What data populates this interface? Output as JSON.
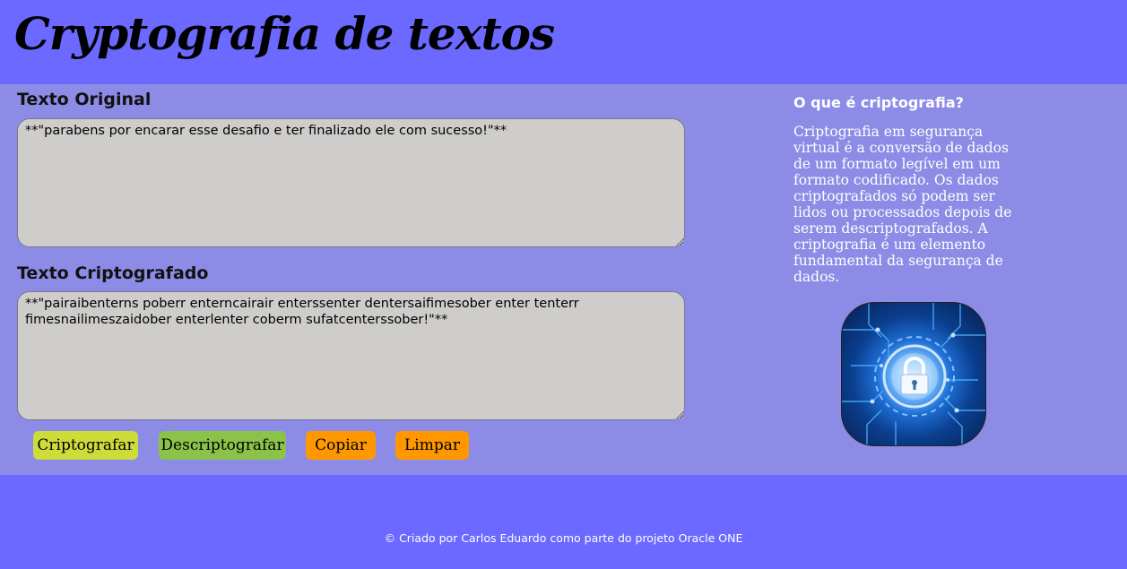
{
  "header": {
    "title": "Cryptografia de textos"
  },
  "main": {
    "original": {
      "label": "Texto Original",
      "value": "**\"parabens por encarar esse desafio e ter finalizado ele com sucesso!\"**"
    },
    "encrypted": {
      "label": "Texto Criptografado",
      "value": "**\"pairaibenterns poberr enterncairair enterssenter dentersaifimesober enter tenterr fimesnailimeszaidober enterlenter coberm sufatcenterssober!\"**"
    },
    "buttons": {
      "encrypt": "Criptografar",
      "decrypt": "Descriptografar",
      "copy": "Copiar",
      "clear": "Limpar"
    },
    "colors": {
      "encrypt": "#cddc39",
      "decrypt": "#8bc34a",
      "copy": "#ff9800",
      "clear": "#ff9800"
    }
  },
  "aside": {
    "title": "O que é criptografia?",
    "text": "Criptografia em segurança virtual é a conversão de dados de um formato legível em um formato codificado. Os dados criptografados só podem ser lidos ou processados depois de serem descriptografados. A criptografia é um elemento fundamental da segurança de dados.",
    "image_icon": "padlock-circuit-icon"
  },
  "footer": {
    "text": "© Criado por Carlos Eduardo como parte do projeto Oracle ONE"
  },
  "theme": {
    "background": "#6b69ff",
    "panel": "#8c8ce6",
    "textarea": "#cecdcb"
  }
}
